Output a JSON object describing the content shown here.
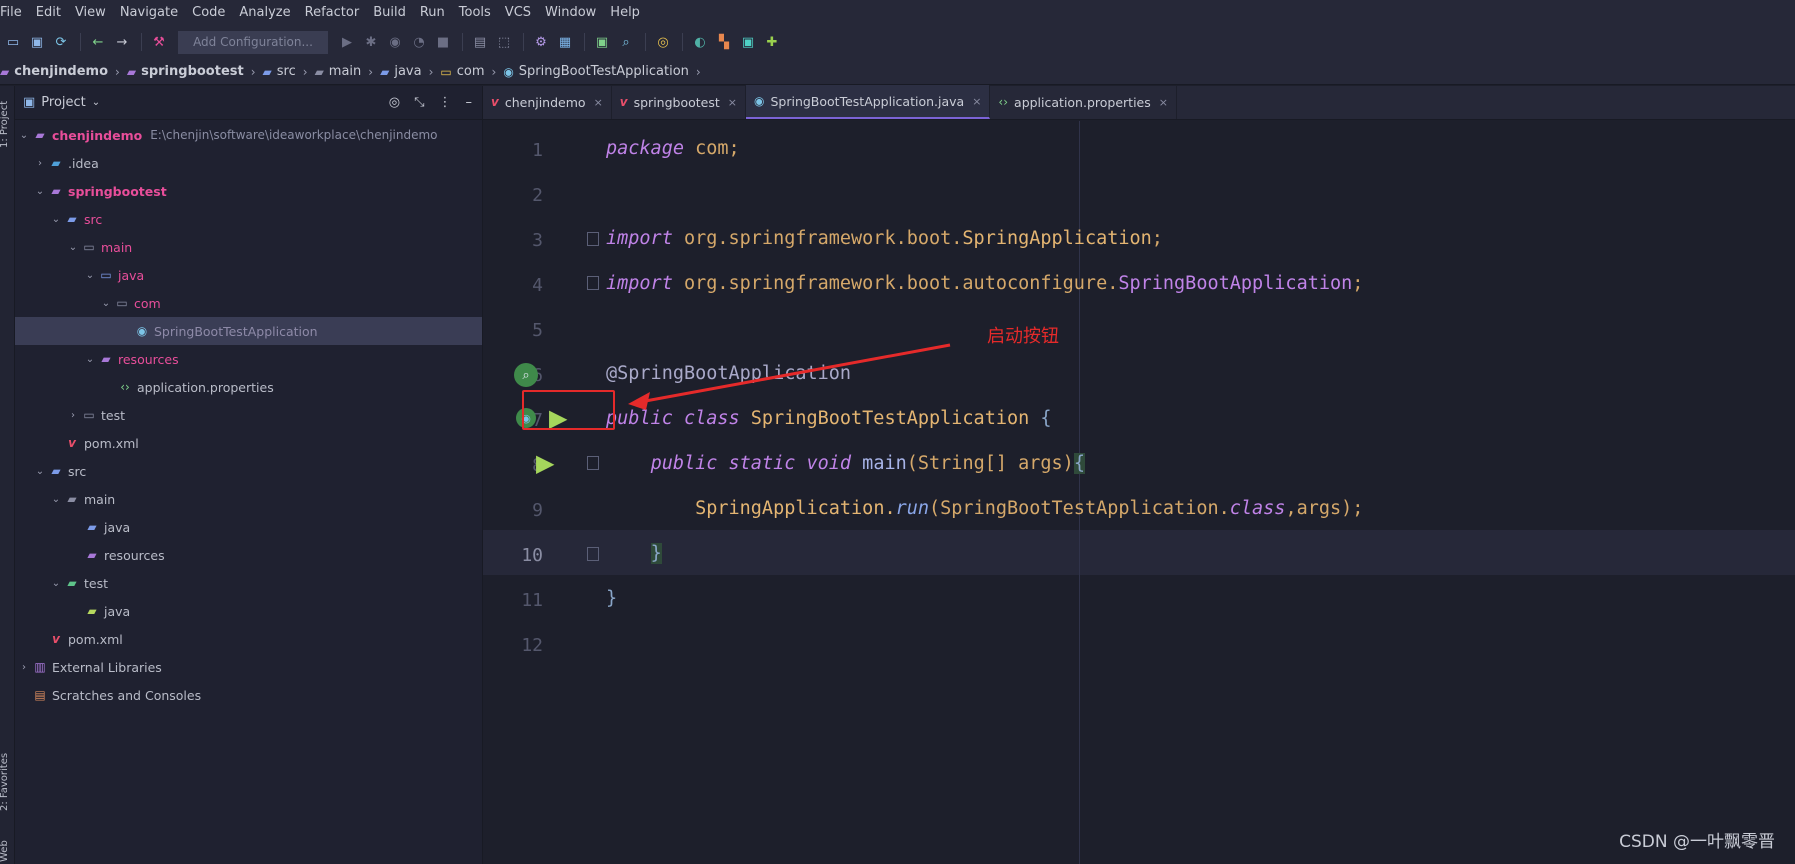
{
  "menu": [
    "File",
    "Edit",
    "View",
    "Navigate",
    "Code",
    "Analyze",
    "Refactor",
    "Build",
    "Run",
    "Tools",
    "VCS",
    "Window",
    "Help"
  ],
  "toolbar": {
    "run_config_placeholder": "Add Configuration..."
  },
  "breadcrumb": [
    "chenjindemo",
    "springbootest",
    "src",
    "main",
    "java",
    "com",
    "SpringBootTestApplication"
  ],
  "side_labels": {
    "project": "1: Project",
    "favorites": "2: Favorites",
    "web": "Web"
  },
  "project_panel": {
    "title": "Project",
    "tree": [
      {
        "label": "chenjindemo",
        "path": "E:\\chenjin\\software\\ideaworkplace\\chenjindemo"
      },
      {
        "label": ".idea"
      },
      {
        "label": "springbootest"
      },
      {
        "label": "src"
      },
      {
        "label": "main"
      },
      {
        "label": "java"
      },
      {
        "label": "com"
      },
      {
        "label": "SpringBootTestApplication"
      },
      {
        "label": "resources"
      },
      {
        "label": "application.properties"
      },
      {
        "label": "test"
      },
      {
        "label": "pom.xml"
      },
      {
        "label": "src"
      },
      {
        "label": "main"
      },
      {
        "label": "java"
      },
      {
        "label": "resources"
      },
      {
        "label": "test"
      },
      {
        "label": "java"
      },
      {
        "label": "pom.xml"
      },
      {
        "label": "External Libraries"
      },
      {
        "label": "Scratches and Consoles"
      }
    ]
  },
  "tabs": [
    {
      "label": "chenjindemo",
      "close": "×"
    },
    {
      "label": "springbootest",
      "close": "×"
    },
    {
      "label": "SpringBootTestApplication.java",
      "close": "×"
    },
    {
      "label": "application.properties",
      "close": "×"
    }
  ],
  "code": {
    "line_numbers": [
      "1",
      "2",
      "3",
      "4",
      "5",
      "6",
      "7",
      "8",
      "9",
      "10",
      "11",
      "12"
    ],
    "l1_kw": "package",
    "l1_rest": " com;",
    "l3_kw": "import",
    "l3_a": " org.springframework.boot.",
    "l3_b": "SpringApplication",
    "l3_c": ";",
    "l4_kw": "import",
    "l4_a": " org.springframework.boot.autoconfigure.",
    "l4_b": "SpringBootApplication",
    "l4_c": ";",
    "l6": "@SpringBootApplication",
    "l7_kw": "public class",
    "l7_name": " SpringBootTestApplication ",
    "l7_br": "{",
    "l8_indent": "    ",
    "l8_kw": "public static void",
    "l8_name": " main",
    "l8_rest": "(String[] args)",
    "l8_br": "{",
    "l9_indent": "        ",
    "l9_a": "SpringApplication.",
    "l9_b": "run",
    "l9_c": "(SpringBootTestApplication.",
    "l9_d": "class",
    "l9_e": ",args);",
    "l10_indent": "    ",
    "l10": "}",
    "l11": "}"
  },
  "annotation": {
    "text": "启动按钮",
    "color": "#e52a2a"
  },
  "watermark": "CSDN @一叶飘零晋"
}
